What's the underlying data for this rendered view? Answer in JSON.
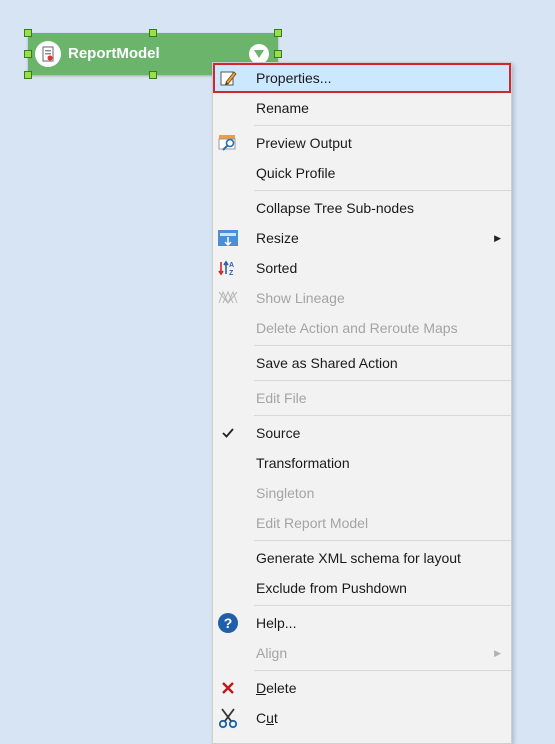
{
  "node": {
    "label": "ReportModel",
    "color": "#6bb46b",
    "handle_color": "#97e04a"
  },
  "menu": {
    "highlight_color": "#cce8ff",
    "highlight_border": "#d0262e",
    "items": [
      {
        "label": "Properties...",
        "icon": "edit-pencil-icon"
      },
      {
        "label": "Rename"
      },
      {
        "label": "Preview Output",
        "icon": "preview-magnifier-icon"
      },
      {
        "label": "Quick Profile"
      },
      {
        "label": "Collapse Tree Sub-nodes"
      },
      {
        "label": "Resize",
        "icon": "resize-icon",
        "submenu": true
      },
      {
        "label": "Sorted",
        "icon": "sort-az-icon"
      },
      {
        "label": "Show Lineage",
        "icon": "lineage-icon",
        "disabled": true
      },
      {
        "label": "Delete Action and Reroute Maps",
        "disabled": true
      },
      {
        "label": "Save as Shared Action"
      },
      {
        "label": "Edit File",
        "disabled": true
      },
      {
        "label": "Source",
        "checked": true
      },
      {
        "label": "Transformation"
      },
      {
        "label": "Singleton",
        "disabled": true
      },
      {
        "label": "Edit Report Model",
        "disabled": true
      },
      {
        "label": "Generate XML schema for layout"
      },
      {
        "label": "Exclude from Pushdown"
      },
      {
        "label": "Help...",
        "icon": "help-icon"
      },
      {
        "label": "Align",
        "disabled": true,
        "submenu": true
      },
      {
        "label": "Delete",
        "icon": "delete-x-icon",
        "underline": "D"
      },
      {
        "label": "Cut",
        "icon": "scissors-icon",
        "underline": "u"
      }
    ]
  }
}
